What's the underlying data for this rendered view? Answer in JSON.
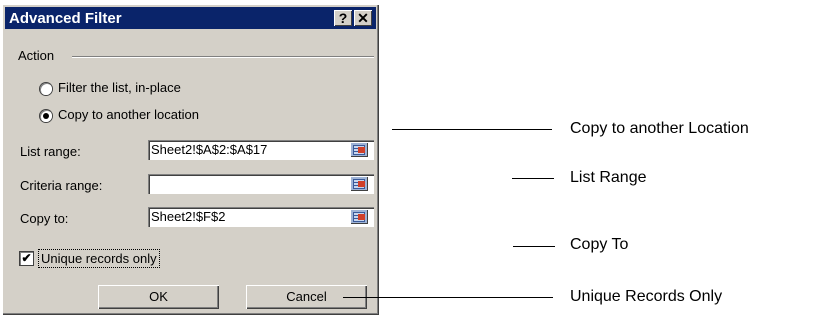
{
  "dialog": {
    "title": "Advanced Filter",
    "help_glyph": "?",
    "close_glyph": "✕",
    "action_group_label": "Action",
    "radios": [
      {
        "label": "Filter the list, in-place",
        "checked": false
      },
      {
        "label": "Copy to another location",
        "checked": true
      }
    ],
    "fields": {
      "list_range": {
        "label": "List range:",
        "value": "Sheet2!$A$2:$A$17"
      },
      "criteria_range": {
        "label": "Criteria range:",
        "value": ""
      },
      "copy_to": {
        "label": "Copy to:",
        "value": "Sheet2!$F$2"
      }
    },
    "unique_checkbox": {
      "label": "Unique records only",
      "checked": true,
      "mark": "✔"
    },
    "ok_label": "OK",
    "cancel_label": "Cancel"
  },
  "annotations": [
    "Copy to another Location",
    "List Range",
    "Copy To",
    "Unique Records Only"
  ]
}
